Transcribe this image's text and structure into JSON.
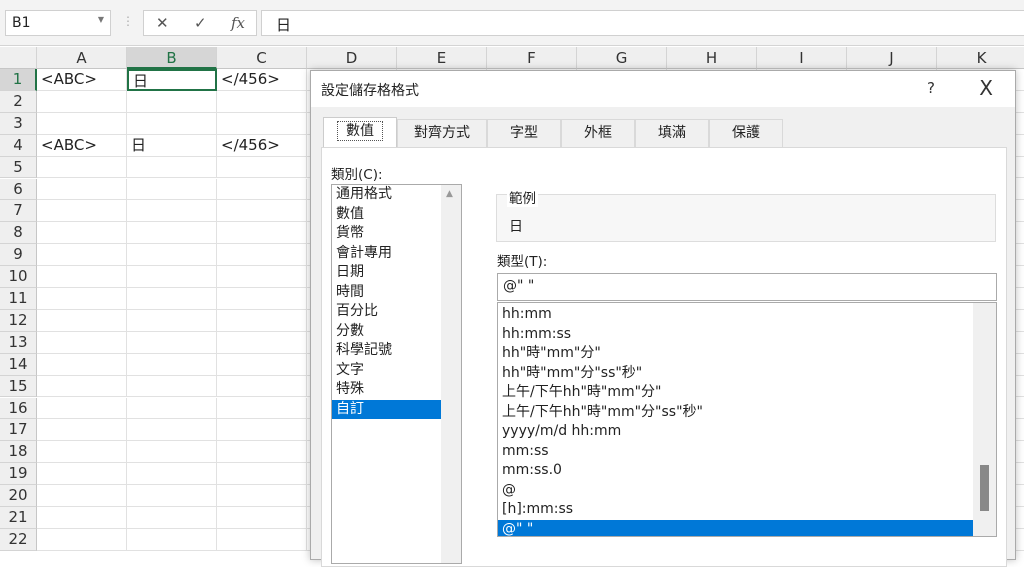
{
  "formula_bar": {
    "name_box": "B1",
    "cancel_icon": "✕",
    "enter_icon": "✓",
    "fx_label": "fx",
    "formula": "日"
  },
  "columns": [
    "A",
    "B",
    "C",
    "D",
    "E",
    "F",
    "G",
    "H",
    "I",
    "J",
    "K"
  ],
  "selected_column": "B",
  "rows": [
    "1",
    "2",
    "3",
    "4",
    "5",
    "6",
    "7",
    "8",
    "9",
    "10",
    "11",
    "12",
    "13",
    "14",
    "15",
    "16",
    "17",
    "18",
    "19",
    "20",
    "21",
    "22"
  ],
  "selected_row": "1",
  "cells": [
    {
      "ref": "A1",
      "value": "<ABC>"
    },
    {
      "ref": "B1",
      "value": "日"
    },
    {
      "ref": "C1",
      "value": "</456>"
    },
    {
      "ref": "A4",
      "value": "<ABC>"
    },
    {
      "ref": "B4",
      "value": "日"
    },
    {
      "ref": "C4",
      "value": "</456>"
    }
  ],
  "dialog": {
    "title": "設定儲存格格式",
    "help": "?",
    "close": "X",
    "tabs": [
      "數值",
      "對齊方式",
      "字型",
      "外框",
      "填滿",
      "保護"
    ],
    "selected_tab": "數值",
    "category_label": "類別(C):",
    "categories": [
      "通用格式",
      "數值",
      "貨幣",
      "會計專用",
      "日期",
      "時間",
      "百分比",
      "分數",
      "科學記號",
      "文字",
      "特殊",
      "自訂"
    ],
    "selected_category": "自訂",
    "sample_label": "範例",
    "sample_value": "日",
    "type_label": "類型(T):",
    "type_value": "@\" \"",
    "formats": [
      "hh:mm",
      "hh:mm:ss",
      "hh\"時\"mm\"分\"",
      "hh\"時\"mm\"分\"ss\"秒\"",
      "上午/下午hh\"時\"mm\"分\"",
      "上午/下午hh\"時\"mm\"分\"ss\"秒\"",
      "yyyy/m/d hh:mm",
      "mm:ss",
      "mm:ss.0",
      "@",
      "[h]:mm:ss",
      "@\" \""
    ],
    "selected_format": "@\" \""
  },
  "colors": {
    "accent": "#217346",
    "selection": "#0078d7"
  }
}
